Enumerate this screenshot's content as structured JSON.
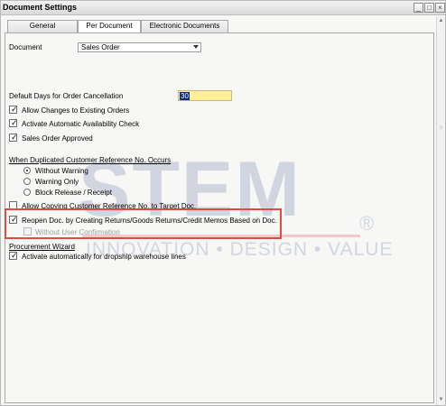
{
  "window": {
    "title": "Document Settings",
    "buttons": {
      "minimize": "_",
      "maximize": "□",
      "close": "×"
    }
  },
  "tabs": [
    {
      "label": "General",
      "active": false
    },
    {
      "label": "Per Document",
      "active": true
    },
    {
      "label": "Electronic Documents",
      "active": false
    }
  ],
  "document": {
    "label": "Document",
    "value": "Sales Order"
  },
  "cancellation": {
    "label": "Default Days for Order Cancellation",
    "value": "30"
  },
  "options": [
    {
      "label": "Allow Changes to Existing Orders",
      "checked": true
    },
    {
      "label": "Activate Automatic Availability Check",
      "checked": true
    },
    {
      "label": "Sales Order Approved",
      "checked": true
    }
  ],
  "duplicate_ref": {
    "heading": "When Duplicated Customer Reference No. Occurs",
    "radios": [
      {
        "label": "Without Warning",
        "selected": true
      },
      {
        "label": "Warning Only",
        "selected": false
      },
      {
        "label": "Block Release / Receipt",
        "selected": false
      }
    ]
  },
  "allow_copying": {
    "label": "Allow Copying Customer Reference No. to Target Doc.",
    "checked": false
  },
  "reopen": {
    "label": "Reopen Doc. by Creating Returns/Goods Returns/Credit Memos Based on Doc.",
    "checked": true
  },
  "without_confirmation": {
    "label": "Without User Confirmation",
    "checked": false,
    "disabled": true
  },
  "procurement": {
    "heading": "Procurement Wizard",
    "option": {
      "label": "Activate automatically for dropship warehouse lines",
      "checked": true
    }
  },
  "watermark": {
    "brand": "STEM",
    "registered": "®",
    "tagline": "INNOVATION • DESIGN • VALUE"
  },
  "colors": {
    "highlight": "#e14b44",
    "input_yellow": "#ffef9b",
    "selection": "#0a2a7a"
  }
}
